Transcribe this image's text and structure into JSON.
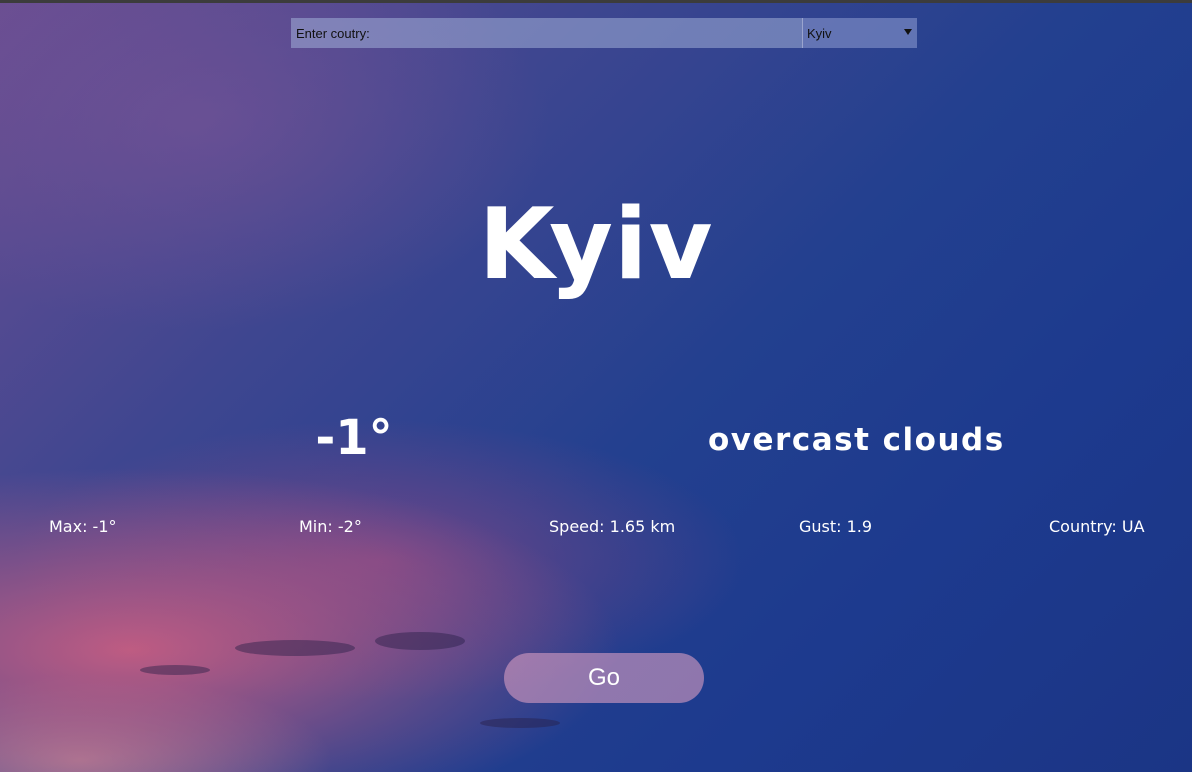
{
  "search": {
    "country_placeholder": "Enter coutry:",
    "country_value": "",
    "city_selected": "Kyiv"
  },
  "weather": {
    "city": "Kyiv",
    "temperature": "-1°",
    "description": "overcast clouds"
  },
  "stats": {
    "max": "Max: -1°",
    "min": "Min: -2°",
    "speed": "Speed: 1.65 km",
    "gust": "Gust: 1.9",
    "country": "Country: UA"
  },
  "actions": {
    "go_label": "Go"
  },
  "colors": {
    "text": "#ffffff",
    "sky_top": "#23408f",
    "sky_pink": "#d66080"
  }
}
